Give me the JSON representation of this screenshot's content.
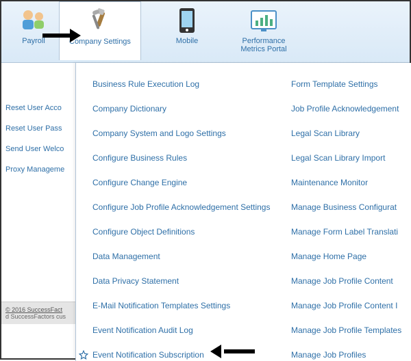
{
  "toolbar": {
    "items": [
      {
        "label": "Payroll"
      },
      {
        "label": "Company Settings"
      },
      {
        "label": "Mobile"
      },
      {
        "label": "Performance\nMetrics Portal"
      }
    ]
  },
  "sidebar": {
    "links": [
      "Reset User Acco",
      "Reset User Pass",
      "Send User Welco",
      "Proxy Manageme"
    ]
  },
  "footer": {
    "copy": "© 2016 SuccessFact",
    "line2": "d SuccessFactors cus"
  },
  "menu": {
    "left": [
      "Business Rule Execution Log",
      "Company Dictionary",
      "Company System and Logo Settings",
      "Configure Business Rules",
      "Configure Change Engine",
      "Configure Job Profile Acknowledgement Settings",
      "Configure Object Definitions",
      "Data Management",
      "Data Privacy Statement",
      "E-Mail Notification Templates Settings",
      "Event Notification Audit Log",
      "Event Notification Subscription"
    ],
    "right": [
      "Form Template Settings",
      "Job Profile Acknowledgement",
      "Legal Scan Library",
      "Legal Scan Library Import",
      "Maintenance Monitor",
      "Manage Business Configurat",
      "Manage Form Label Translati",
      "Manage Home Page",
      "Manage Job Profile Content",
      "Manage Job Profile Content I",
      "Manage Job Profile Templates",
      "Manage Job Profiles"
    ]
  }
}
